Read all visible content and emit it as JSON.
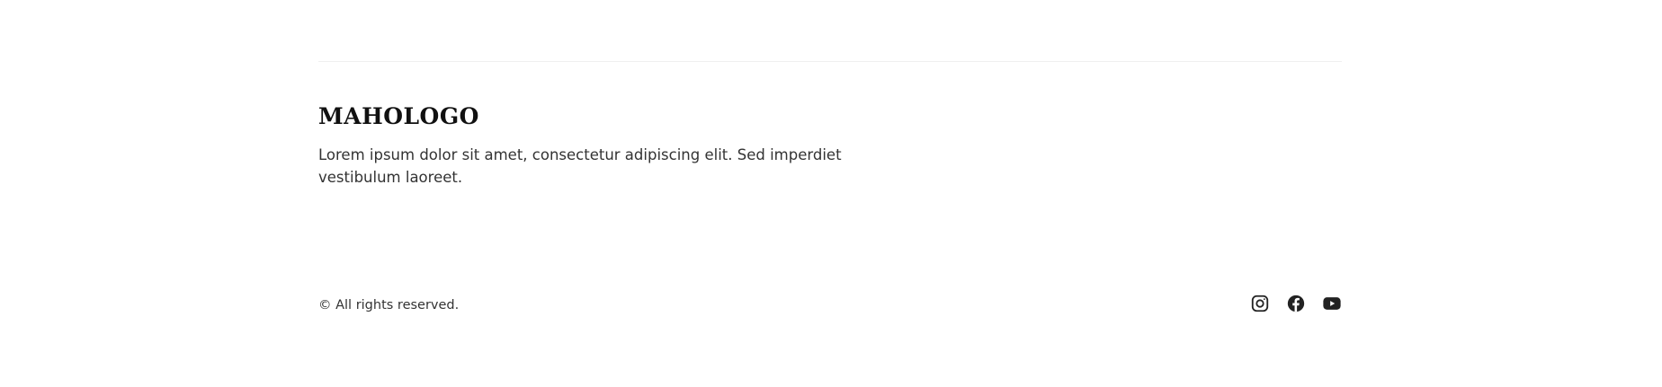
{
  "footer": {
    "logo_text": "MAHOLOGO",
    "tagline": "Lorem ipsum dolor sit amet, consectetur adipiscing elit. Sed imperdiet vestibulum laoreet.",
    "copyright": "© All rights reserved.",
    "social_links": [
      {
        "icon": "instagram-icon"
      },
      {
        "icon": "facebook-icon"
      },
      {
        "icon": "youtube-icon"
      }
    ]
  },
  "colors": {
    "background": "#ffffff",
    "text": "#333333",
    "logo": "#111111",
    "icon": "#222222",
    "divider": "#f0f0f0"
  }
}
